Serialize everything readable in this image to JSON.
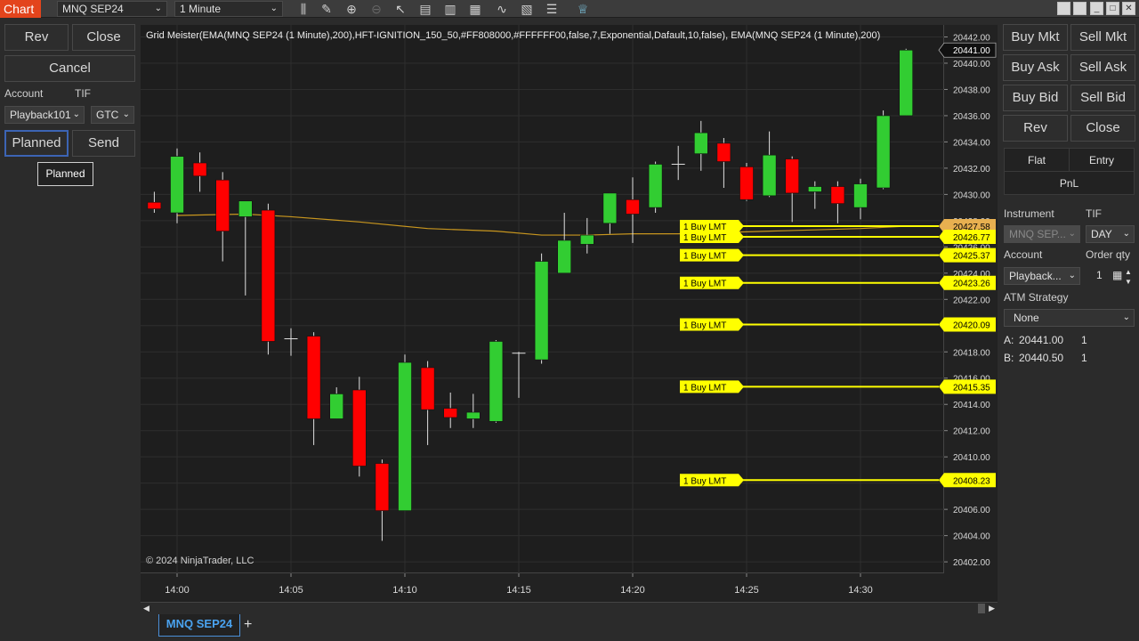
{
  "topbar": {
    "tab_label": "Chart",
    "instrument": "MNQ SEP24",
    "interval": "1 Minute",
    "tool_icons": [
      "bar-type-icon",
      "draw-icon",
      "zoom-in-icon",
      "zoom-out-icon",
      "pointer-icon",
      "data-box-icon",
      "templates-icon",
      "strategies-icon",
      "indicators-icon",
      "properties-icon",
      "list-icon",
      "chart-trader-icon"
    ],
    "window_buttons": [
      "restore-icon",
      "minimize-icon",
      "maximize-icon",
      "close-icon"
    ]
  },
  "left_panel": {
    "rev": "Rev",
    "close": "Close",
    "cancel": "Cancel",
    "account_label": "Account",
    "tif_label": "TIF",
    "account_value": "Playback101",
    "tif_value": "GTC",
    "planned": "Planned",
    "send": "Send",
    "tooltip": "Planned"
  },
  "chart": {
    "indicator_title": "Grid Meister(EMA(MNQ SEP24 (1 Minute),200),HFT-IGNITION_150_50,#FF808000,#FFFFFF00,false,7,Exponential,Dafault,10,false), EMA(MNQ SEP24 (1 Minute),200)",
    "copyright": "© 2024 NinjaTrader, LLC",
    "last_price": "20441.00",
    "ema_price": "20427.58",
    "buy_label": "1 Buy LMT"
  },
  "chart_data": {
    "type": "candlestick",
    "ylim": [
      20401.3,
      20443.1
    ],
    "y_ticks": [
      "20442.00",
      "20440.00",
      "20438.00",
      "20436.00",
      "20434.00",
      "20432.00",
      "20430.00",
      "20428.00",
      "20426.00",
      "20424.00",
      "20422.00",
      "20420.00",
      "20418.00",
      "20416.00",
      "20414.00",
      "20412.00",
      "20410.00",
      "20408.00",
      "20406.00",
      "20404.00",
      "20402.00"
    ],
    "x_ticks": [
      {
        "label": "14:00",
        "bar": 0
      },
      {
        "label": "14:05",
        "bar": 5
      },
      {
        "label": "14:10",
        "bar": 10
      },
      {
        "label": "14:15",
        "bar": 15
      },
      {
        "label": "14:20",
        "bar": 20
      },
      {
        "label": "14:25",
        "bar": 25
      },
      {
        "label": "14:30",
        "bar": 30
      }
    ],
    "first_bar_index": -1,
    "candles": [
      {
        "o": 20429.4,
        "h": 20430.2,
        "l": 20428.6,
        "c": 20428.9
      },
      {
        "o": 20428.6,
        "h": 20433.5,
        "l": 20427.8,
        "c": 20432.9
      },
      {
        "o": 20432.4,
        "h": 20433.2,
        "l": 20430.2,
        "c": 20431.4
      },
      {
        "o": 20431.1,
        "h": 20431.7,
        "l": 20424.9,
        "c": 20427.2
      },
      {
        "o": 20428.3,
        "h": 20429.3,
        "l": 20422.3,
        "c": 20429.5
      },
      {
        "o": 20428.8,
        "h": 20429.3,
        "l": 20417.8,
        "c": 20418.8
      },
      {
        "o": 20418.9,
        "h": 20419.8,
        "l": 20417.7,
        "c": 20419.0
      },
      {
        "o": 20419.2,
        "h": 20419.5,
        "l": 20410.9,
        "c": 20412.9
      },
      {
        "o": 20412.9,
        "h": 20415.3,
        "l": 20412.9,
        "c": 20414.8
      },
      {
        "o": 20415.1,
        "h": 20416.1,
        "l": 20408.5,
        "c": 20409.3
      },
      {
        "o": 20409.5,
        "h": 20409.8,
        "l": 20403.6,
        "c": 20405.9
      },
      {
        "o": 20405.9,
        "h": 20417.8,
        "l": 20405.9,
        "c": 20417.2
      },
      {
        "o": 20416.8,
        "h": 20417.3,
        "l": 20410.9,
        "c": 20413.6
      },
      {
        "o": 20413.7,
        "h": 20414.9,
        "l": 20412.2,
        "c": 20413.0
      },
      {
        "o": 20412.9,
        "h": 20414.8,
        "l": 20412.2,
        "c": 20413.4
      },
      {
        "o": 20412.7,
        "h": 20418.9,
        "l": 20412.6,
        "c": 20418.8
      },
      {
        "o": 20417.8,
        "h": 20418.0,
        "l": 20414.5,
        "c": 20417.9
      },
      {
        "o": 20417.4,
        "h": 20425.5,
        "l": 20417.1,
        "c": 20424.9
      },
      {
        "o": 20424.0,
        "h": 20428.6,
        "l": 20424.0,
        "c": 20426.5
      },
      {
        "o": 20426.2,
        "h": 20428.2,
        "l": 20425.5,
        "c": 20426.9
      },
      {
        "o": 20427.8,
        "h": 20430.1,
        "l": 20427.0,
        "c": 20430.1
      },
      {
        "o": 20429.6,
        "h": 20431.3,
        "l": 20426.3,
        "c": 20428.5
      },
      {
        "o": 20429.0,
        "h": 20432.5,
        "l": 20428.6,
        "c": 20432.3
      },
      {
        "o": 20432.3,
        "h": 20433.7,
        "l": 20431.1,
        "c": 20432.3
      },
      {
        "o": 20433.1,
        "h": 20435.6,
        "l": 20431.8,
        "c": 20434.7
      },
      {
        "o": 20433.9,
        "h": 20434.3,
        "l": 20430.5,
        "c": 20432.5
      },
      {
        "o": 20432.1,
        "h": 20432.4,
        "l": 20429.5,
        "c": 20429.6
      },
      {
        "o": 20429.9,
        "h": 20434.8,
        "l": 20429.8,
        "c": 20433.0
      },
      {
        "o": 20432.7,
        "h": 20432.9,
        "l": 20427.9,
        "c": 20430.1
      },
      {
        "o": 20430.2,
        "h": 20431.0,
        "l": 20428.9,
        "c": 20430.6
      },
      {
        "o": 20430.6,
        "h": 20431.0,
        "l": 20427.8,
        "c": 20429.3
      },
      {
        "o": 20429.0,
        "h": 20431.2,
        "l": 20428.1,
        "c": 20430.8
      },
      {
        "o": 20430.5,
        "h": 20436.4,
        "l": 20430.4,
        "c": 20436.0
      },
      {
        "o": 20436.0,
        "h": 20441.1,
        "l": 20436.0,
        "c": 20441.0
      }
    ],
    "ema_color": "#c8961e",
    "up_color": "#32cd32",
    "down_color": "#ff0000",
    "order_lines": [
      {
        "label": "1 Buy LMT",
        "price": "20427.58",
        "highlight": true
      },
      {
        "label": "1 Buy LMT",
        "price": "20426.77"
      },
      {
        "label": "1 Buy LMT",
        "price": "20425.37"
      },
      {
        "label": "1 Buy LMT",
        "price": "20423.26"
      },
      {
        "label": "1 Buy LMT",
        "price": "20420.09"
      },
      {
        "label": "1 Buy LMT",
        "price": "20415.35"
      },
      {
        "label": "1 Buy LMT",
        "price": "20408.23"
      }
    ]
  },
  "bottom": {
    "tab": "MNQ SEP24",
    "add": "+"
  },
  "right_panel": {
    "buy_mkt": "Buy Mkt",
    "sell_mkt": "Sell Mkt",
    "buy_ask": "Buy Ask",
    "sell_ask": "Sell Ask",
    "buy_bid": "Buy Bid",
    "sell_bid": "Sell Bid",
    "rev": "Rev",
    "close": "Close",
    "flat": "Flat",
    "entry": "Entry",
    "pnl": "PnL",
    "instrument_label": "Instrument",
    "tif_label": "TIF",
    "instrument_value": "MNQ SEP...",
    "tif_value": "DAY",
    "account_label": "Account",
    "order_qty_label": "Order qty",
    "account_value": "Playback...",
    "order_qty": "1",
    "atm_label": "ATM Strategy",
    "atm_value": "None",
    "ask_label": "A:",
    "ask_price": "20441.00",
    "ask_size": "1",
    "bid_label": "B:",
    "bid_price": "20440.50",
    "bid_size": "1"
  }
}
